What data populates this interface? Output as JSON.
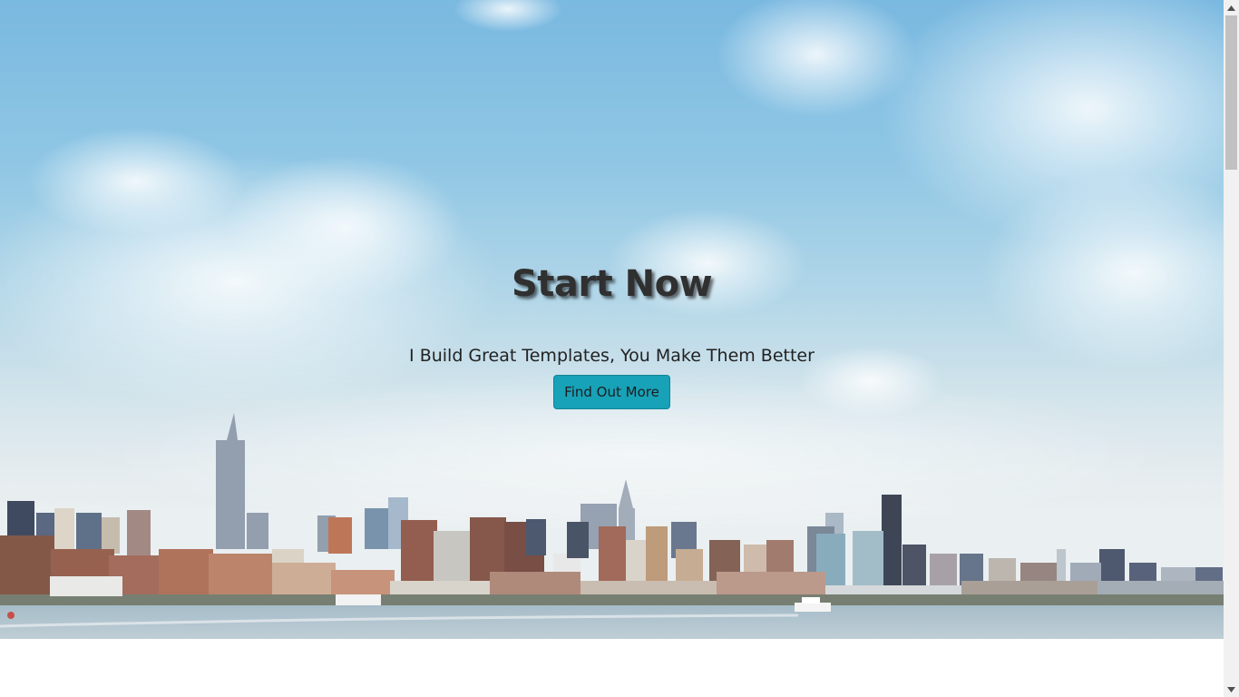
{
  "hero": {
    "title": "Start Now",
    "subtitle": "I Build Great Templates, You Make Them Better",
    "button_label": "Find Out More",
    "background_image": "city-skyline-over-water",
    "button_color": "#17a2b8"
  },
  "scrollbar": {
    "up_icon": "scroll-up-arrow-icon",
    "down_icon": "scroll-down-arrow-icon"
  }
}
